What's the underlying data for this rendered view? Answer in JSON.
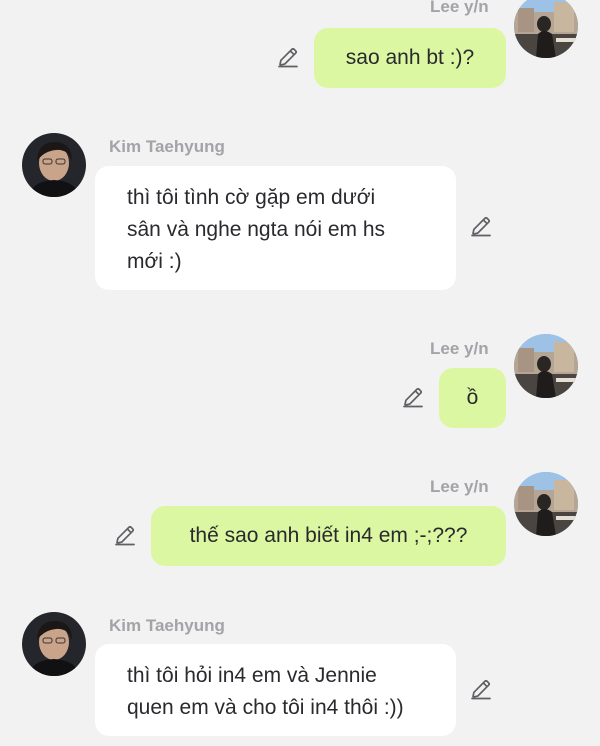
{
  "me": {
    "name": "Lee y/n"
  },
  "them": {
    "name": "Kim Taehyung"
  },
  "messages": [
    {
      "sender": "me",
      "name": "Lee y/n",
      "text": "sao anh bt :)?"
    },
    {
      "sender": "them",
      "name": "Kim Taehyung",
      "lines": [
        "thì tôi tình cờ gặp em dưới",
        "sân và nghe ngta nói em hs",
        "mới :)"
      ]
    },
    {
      "sender": "me",
      "name": "Lee y/n",
      "text": "ồ"
    },
    {
      "sender": "me",
      "name": "Lee y/n",
      "text": "thế sao anh biết in4 em ;-;???"
    },
    {
      "sender": "them",
      "name": "Kim Taehyung",
      "lines": [
        "thì tôi hỏi in4 em và Jennie",
        "quen em và cho tôi in4 thôi :))"
      ]
    }
  ],
  "icons": {
    "edit": "pencil-edit-icon",
    "avatar_me": "avatar-lee",
    "avatar_them": "avatar-kim"
  },
  "colors": {
    "background": "#f2f2f3",
    "outgoing_bubble": "#dcf7a1",
    "incoming_bubble": "#ffffff",
    "name_text": "#a3a3a8",
    "message_text": "#2a2a2e"
  }
}
